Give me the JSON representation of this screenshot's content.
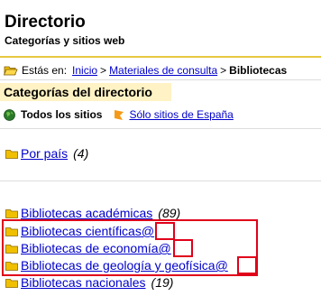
{
  "header": {
    "title": "Directorio",
    "subtitle": "Categorías y sitios web"
  },
  "breadcrumb": {
    "prefix": "Estás en:",
    "items": [
      "Inicio",
      "Materiales de consulta"
    ],
    "separator": ">",
    "current": "Bibliotecas"
  },
  "category_header": "Categorías del directorio",
  "filters": {
    "all_sites": "Todos los sitios",
    "spain_only": "Sólo sitios de España"
  },
  "by_country": {
    "label": "Por país",
    "count": "(4)"
  },
  "categories": [
    {
      "label": "Bibliotecas académicas",
      "count": "(89)",
      "at": ""
    },
    {
      "label": "Bibliotecas científicas",
      "count": "",
      "at": "@"
    },
    {
      "label": "Bibliotecas de economía",
      "count": "",
      "at": "@"
    },
    {
      "label": "Bibliotecas de geología y geofísica",
      "count": "",
      "at": "@"
    },
    {
      "label": "Bibliotecas nacionales",
      "count": "(19)",
      "at": ""
    }
  ],
  "colors": {
    "link": "#0000cc",
    "category_header_bg": "#fff2c4",
    "highlight_box": "#e0001a",
    "folder": "#f0c000"
  },
  "icons": [
    "folder-open-icon",
    "globe-icon",
    "spain-flag-icon",
    "folder-icon"
  ]
}
